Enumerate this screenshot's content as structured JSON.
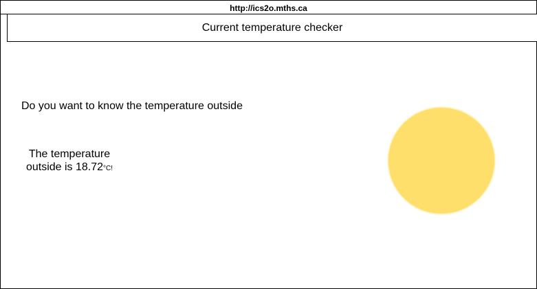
{
  "browser": {
    "url": "http://ics2o.mths.ca"
  },
  "header": {
    "title": "Current temperature checker"
  },
  "main": {
    "question": "Do you want to know the temperature outside",
    "result": {
      "prefix": "The temperature outside is",
      "value": "18.72",
      "unit": "°C!"
    },
    "sun_icon": {
      "name": "sun-icon",
      "color": "#ffdf6b"
    }
  }
}
